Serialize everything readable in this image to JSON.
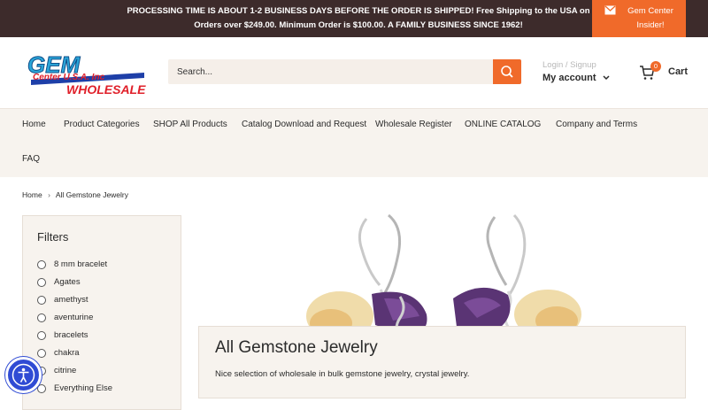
{
  "announcement": {
    "text": "PROCESSING TIME IS ABOUT 1-2 BUSINESS DAYS BEFORE THE ORDER IS SHIPPED! Free Shipping to the USA on Orders over $249.00. Minimum Order is $100.00. A FAMILY BUSINESS SINCE 1962!",
    "insider_label": "Gem Center Insider!"
  },
  "header": {
    "logo_line1": "GEM",
    "logo_line2": "Center U.S.A. Inc",
    "logo_line3": "WHOLESALE",
    "search_placeholder": "Search...",
    "login_label": "Login / Signup",
    "account_label": "My account",
    "cart_count": "0",
    "cart_label": "Cart"
  },
  "nav": {
    "items": [
      "Home",
      "Product Categories",
      "SHOP All Products",
      "Catalog Download and Request",
      "Wholesale Register",
      "ONLINE CATALOG",
      "Company and Terms",
      "FAQ"
    ]
  },
  "breadcrumb": {
    "home": "Home",
    "current": "All Gemstone Jewelry"
  },
  "filters": {
    "title": "Filters",
    "options": [
      "8 mm bracelet",
      "Agates",
      "amethyst",
      "aventurine",
      "bracelets",
      "chakra",
      "citrine",
      "Everything Else"
    ]
  },
  "collection": {
    "title": "All Gemstone Jewelry",
    "description": "Nice selection of wholesale in bulk gemstone jewelry, crystal jewelry."
  },
  "colors": {
    "accent": "#f06a2a",
    "announcement_bg": "#3d2b2b",
    "nav_bg": "#f7f3ee",
    "accessibility": "#2f4bd4"
  },
  "icons": [
    "mail-icon",
    "search-icon",
    "chevron-down-icon",
    "cart-icon",
    "chevron-right-icon",
    "accessibility-icon"
  ]
}
